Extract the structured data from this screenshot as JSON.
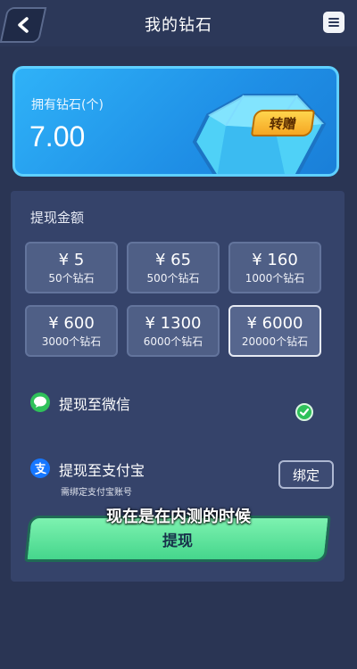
{
  "header": {
    "title": "我的钻石",
    "back_icon": "chevron-left-icon",
    "menu_icon": "menu-icon"
  },
  "balance": {
    "label": "拥有钻石(个)",
    "value": "7.00",
    "transfer_label": "转赠"
  },
  "withdraw": {
    "section_label": "提现金额",
    "options": [
      {
        "price": "¥ 5",
        "diamonds": "50个钻石",
        "selected": false
      },
      {
        "price": "¥ 65",
        "diamonds": "500个钻石",
        "selected": false
      },
      {
        "price": "¥ 160",
        "diamonds": "1000个钻石",
        "selected": false
      },
      {
        "price": "¥ 600",
        "diamonds": "3000个钻石",
        "selected": false
      },
      {
        "price": "¥ 1300",
        "diamonds": "6000个钻石",
        "selected": false
      },
      {
        "price": "¥ 6000",
        "diamonds": "20000个钻石",
        "selected": true
      }
    ]
  },
  "payment": {
    "wechat_label": "提现至微信",
    "wechat_selected": true,
    "alipay_label": "提现至支付宝",
    "alipay_sub": "需绑定支付宝账号",
    "bind_label": "绑定"
  },
  "caption": "现在是在内测的时候",
  "submit_label": "提现",
  "colors": {
    "background": "#2a3554",
    "panel": "#35436a",
    "accent_blue": "#2fb2f8",
    "accent_green": "#45d68c",
    "gold": "#f5a623"
  }
}
